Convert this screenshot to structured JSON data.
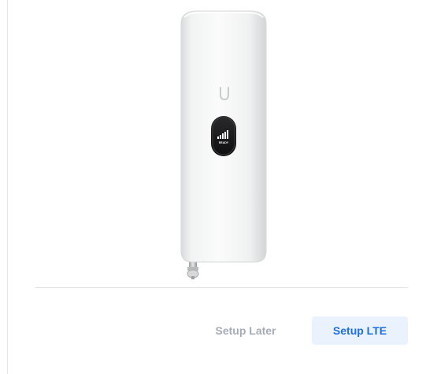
{
  "device": {
    "image_icon": "ubiquiti-lte-device-icon",
    "screen_label": "READY"
  },
  "actions": {
    "setup_later_label": "Setup Later",
    "setup_lte_label": "Setup LTE"
  },
  "colors": {
    "primary": "#1e6fe0",
    "primary_bg": "#eaf2fd",
    "secondary_text": "#a6acb6"
  }
}
